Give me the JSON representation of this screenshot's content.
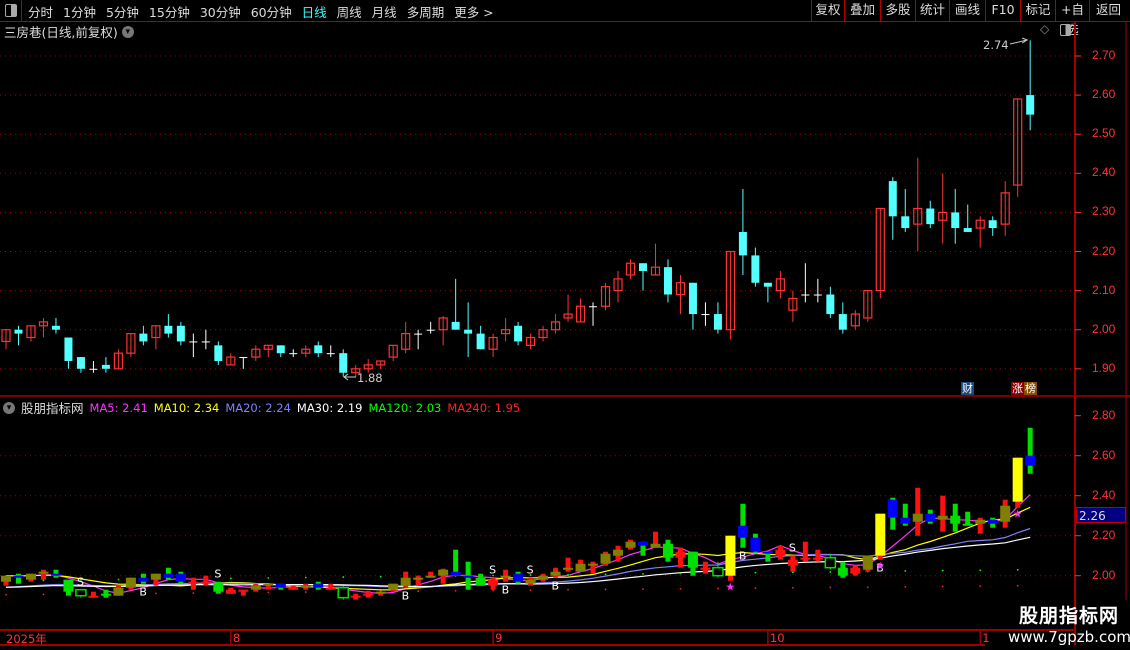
{
  "toolbar": {
    "periods": [
      "分时",
      "1分钟",
      "5分钟",
      "15分钟",
      "30分钟",
      "60分钟",
      "日线",
      "周线",
      "月线",
      "多周期",
      "更多 >"
    ],
    "active_period": "日线",
    "buttons": [
      "复权",
      "叠加",
      "多股",
      "统计",
      "画线",
      "F10",
      "标记",
      "+自选",
      "返回"
    ]
  },
  "main": {
    "title": "三房巷(日线,前复权)",
    "price_axis": [
      "2.70",
      "2.60",
      "2.50",
      "2.40",
      "2.30",
      "2.20",
      "2.10",
      "2.00",
      "1.90"
    ],
    "high_label": "2.74",
    "low_label": "1.88",
    "badges": {
      "cai": "财",
      "zhang": "涨",
      "bang": "榜"
    },
    "candles": [
      [
        1.97,
        2.0,
        1.95,
        2.0
      ],
      [
        2.0,
        2.01,
        1.96,
        1.99
      ],
      [
        1.98,
        2.01,
        1.97,
        2.01
      ],
      [
        2.01,
        2.03,
        1.98,
        2.02
      ],
      [
        2.01,
        2.03,
        1.99,
        2.0
      ],
      [
        1.98,
        1.98,
        1.9,
        1.92
      ],
      [
        1.93,
        1.93,
        1.89,
        1.9
      ],
      [
        1.9,
        1.92,
        1.89,
        1.9
      ],
      [
        1.91,
        1.93,
        1.89,
        1.9
      ],
      [
        1.9,
        1.95,
        1.9,
        1.94
      ],
      [
        1.94,
        1.99,
        1.93,
        1.99
      ],
      [
        1.99,
        2.01,
        1.96,
        1.97
      ],
      [
        1.98,
        2.01,
        1.95,
        2.01
      ],
      [
        2.01,
        2.04,
        1.98,
        1.99
      ],
      [
        2.01,
        2.02,
        1.96,
        1.97
      ],
      [
        1.97,
        1.99,
        1.93,
        1.97
      ],
      [
        1.97,
        2.0,
        1.95,
        1.97
      ],
      [
        1.96,
        1.97,
        1.91,
        1.92
      ],
      [
        1.91,
        1.94,
        1.91,
        1.93
      ],
      [
        1.93,
        1.93,
        1.9,
        1.93
      ],
      [
        1.93,
        1.96,
        1.92,
        1.95
      ],
      [
        1.95,
        1.96,
        1.93,
        1.96
      ],
      [
        1.96,
        1.96,
        1.93,
        1.94
      ],
      [
        1.94,
        1.95,
        1.93,
        1.94
      ],
      [
        1.94,
        1.96,
        1.93,
        1.95
      ],
      [
        1.96,
        1.97,
        1.93,
        1.94
      ],
      [
        1.94,
        1.96,
        1.93,
        1.94
      ],
      [
        1.94,
        1.95,
        1.88,
        1.89
      ],
      [
        1.89,
        1.91,
        1.88,
        1.9
      ],
      [
        1.9,
        1.925,
        1.89,
        1.91
      ],
      [
        1.91,
        1.92,
        1.9,
        1.92
      ],
      [
        1.93,
        1.96,
        1.92,
        1.96
      ],
      [
        1.95,
        2.02,
        1.94,
        1.99
      ],
      [
        1.99,
        2.0,
        1.95,
        1.99
      ],
      [
        2.0,
        2.02,
        1.99,
        2.0
      ],
      [
        2.0,
        2.035,
        1.96,
        2.03
      ],
      [
        2.02,
        2.13,
        2.0,
        2.0
      ],
      [
        2.0,
        2.07,
        1.93,
        1.99
      ],
      [
        1.99,
        2.01,
        1.95,
        1.95
      ],
      [
        1.95,
        1.99,
        1.93,
        1.98
      ],
      [
        1.99,
        2.03,
        1.97,
        2.0
      ],
      [
        2.01,
        2.02,
        1.96,
        1.97
      ],
      [
        1.96,
        1.99,
        1.95,
        1.98
      ],
      [
        1.98,
        2.01,
        1.97,
        2.0
      ],
      [
        2.0,
        2.04,
        1.99,
        2.02
      ],
      [
        2.03,
        2.09,
        2.02,
        2.04
      ],
      [
        2.02,
        2.08,
        2.02,
        2.06
      ],
      [
        2.06,
        2.07,
        2.01,
        2.06
      ],
      [
        2.06,
        2.12,
        2.05,
        2.11
      ],
      [
        2.1,
        2.15,
        2.07,
        2.13
      ],
      [
        2.14,
        2.18,
        2.13,
        2.17
      ],
      [
        2.17,
        2.17,
        2.1,
        2.15
      ],
      [
        2.14,
        2.22,
        2.14,
        2.16
      ],
      [
        2.16,
        2.18,
        2.07,
        2.09
      ],
      [
        2.09,
        2.14,
        2.04,
        2.12
      ],
      [
        2.12,
        2.12,
        2.0,
        2.04
      ],
      [
        2.04,
        2.07,
        2.01,
        2.04
      ],
      [
        2.04,
        2.07,
        1.99,
        2.0
      ],
      [
        2.0,
        2.2,
        1.975,
        2.2
      ],
      [
        2.25,
        2.36,
        2.14,
        2.19
      ],
      [
        2.19,
        2.21,
        2.11,
        2.12
      ],
      [
        2.12,
        2.12,
        2.07,
        2.11
      ],
      [
        2.1,
        2.15,
        2.08,
        2.13
      ],
      [
        2.05,
        2.1,
        2.02,
        2.08
      ],
      [
        2.09,
        2.17,
        2.07,
        2.09
      ],
      [
        2.09,
        2.13,
        2.07,
        2.09
      ],
      [
        2.09,
        2.11,
        2.03,
        2.04
      ],
      [
        2.04,
        2.07,
        1.99,
        2.0
      ],
      [
        2.01,
        2.05,
        2.0,
        2.04
      ],
      [
        2.03,
        2.1,
        2.02,
        2.1
      ],
      [
        2.1,
        2.31,
        2.08,
        2.31
      ],
      [
        2.38,
        2.39,
        2.23,
        2.29
      ],
      [
        2.29,
        2.36,
        2.25,
        2.26
      ],
      [
        2.27,
        2.44,
        2.2,
        2.31
      ],
      [
        2.31,
        2.33,
        2.26,
        2.27
      ],
      [
        2.28,
        2.4,
        2.22,
        2.3
      ],
      [
        2.3,
        2.36,
        2.22,
        2.26
      ],
      [
        2.26,
        2.32,
        2.25,
        2.25
      ],
      [
        2.26,
        2.29,
        2.21,
        2.28
      ],
      [
        2.28,
        2.29,
        2.24,
        2.26
      ],
      [
        2.27,
        2.38,
        2.24,
        2.35
      ],
      [
        2.37,
        2.59,
        2.34,
        2.59
      ],
      [
        2.6,
        2.74,
        2.51,
        2.55
      ]
    ]
  },
  "indicator": {
    "name": "股朋指标网",
    "ma": [
      {
        "label": "MA5: 2.41",
        "color": "#ff33ff"
      },
      {
        "label": "MA10: 2.34",
        "color": "#ffff00"
      },
      {
        "label": "MA20: 2.24",
        "color": "#8080ff"
      },
      {
        "label": "MA30: 2.19",
        "color": "#ffffff"
      },
      {
        "label": "MA120: 2.03",
        "color": "#00ff00"
      },
      {
        "label": "MA240: 1.95",
        "color": "#ff2020"
      }
    ],
    "axis": [
      "2.80",
      "2.60",
      "2.40",
      "2.20",
      "2.00"
    ],
    "current_value": "2.26",
    "markers": [
      {
        "type": "S",
        "candle": 6
      },
      {
        "type": "B",
        "candle": 11
      },
      {
        "type": "S",
        "candle": 17
      },
      {
        "type": "B",
        "candle": 32
      },
      {
        "type": "S",
        "candle": 39
      },
      {
        "type": "B",
        "candle": 40
      },
      {
        "type": "S",
        "candle": 42
      },
      {
        "type": "B",
        "candle": 44
      },
      {
        "type": "B",
        "candle": 59
      },
      {
        "type": "S",
        "candle": 63
      },
      {
        "type": "B",
        "candle": 70
      }
    ],
    "stars": [
      58,
      70,
      81
    ]
  },
  "time_axis": [
    {
      "label": "2025年",
      "candle": 0
    },
    {
      "label": "8",
      "candle": 18
    },
    {
      "label": "9",
      "candle": 39
    },
    {
      "label": "10",
      "candle": 61
    },
    {
      "label": "1",
      "candle": 78
    }
  ],
  "watermark": {
    "name": "股朋指标网",
    "url": "www.7gpzb.com"
  },
  "colors": {
    "up": "#ff3232",
    "down": "#54ffff",
    "flat": "#ffffff",
    "grid": "#a00000",
    "axis": "#ff3333"
  }
}
